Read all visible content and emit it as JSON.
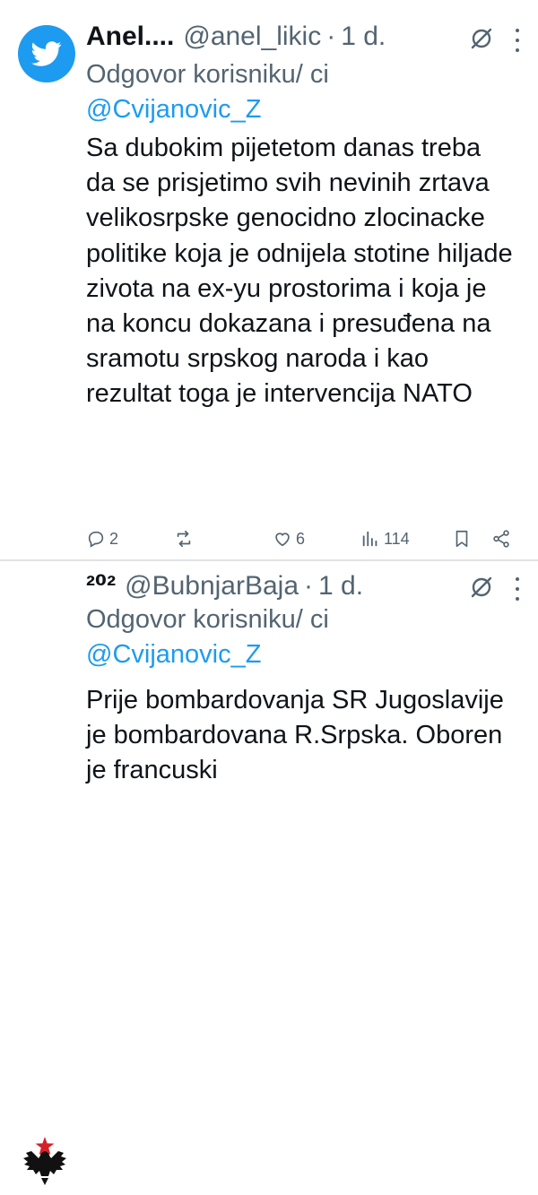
{
  "tweets": [
    {
      "name": "Anel....",
      "handle": "@anel_likic",
      "separator": "·",
      "time": "1 d.",
      "reply_prefix": "Odgovor korisniku/ ci",
      "reply_mention": "@Cvijanovic_Z",
      "body": "Sa dubokim pijetetom danas treba da se prisjetimo svih nevinih zrtava velikosrpske genocidno zlocinacke politike koja je odnijela stotine hiljade zivota na ex-yu prostorima i koja je na koncu dokazana i presuđena na sramotu srpskog naroda i kao rezultat toga je intervencija NATO",
      "avatar_icon": "twitter-bird-icon",
      "replies": "2",
      "retweets": "",
      "likes": "6",
      "views": "114"
    },
    {
      "name": "²⁰²",
      "handle": "@BubnjarBaja",
      "separator": "·",
      "time": "1 d.",
      "reply_prefix": "Odgovor korisniku/ ci",
      "reply_mention": "@Cvijanovic_Z",
      "body": "Prije bombardovanja SR Jugoslavije je bombardovana R.Srpska. Oboren je francuski",
      "avatar_icon": "eagle-star-icon"
    }
  ],
  "colors": {
    "accent": "#1d9bf0",
    "secondary_text": "#536471",
    "primary_text": "#0f1419",
    "divider": "#dfe3e7",
    "star_red": "#d6202a"
  }
}
